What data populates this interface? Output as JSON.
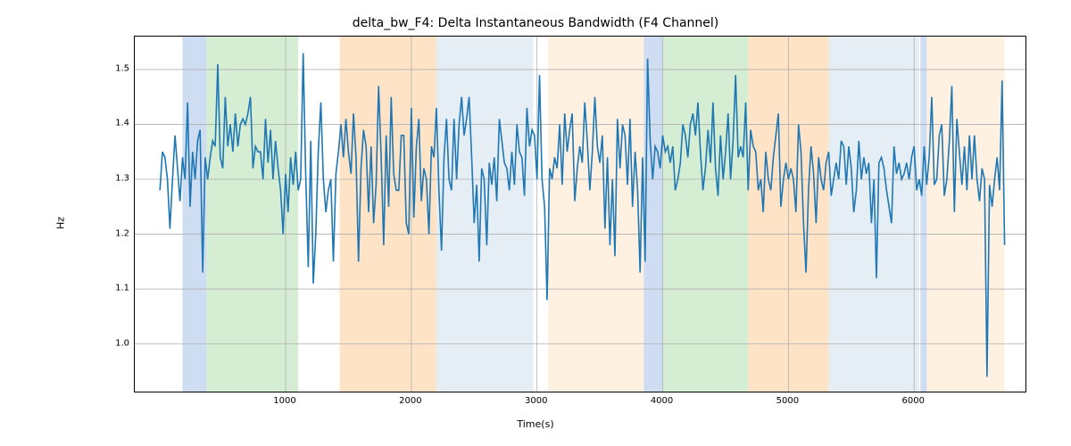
{
  "chart_data": {
    "type": "line",
    "title": "delta_bw_F4: Delta Instantaneous Bandwidth (F4 Channel)",
    "xlabel": "Time(s)",
    "ylabel": "Hz",
    "xlim": [
      -200,
      6900
    ],
    "ylim": [
      0.91,
      1.56
    ],
    "xticks": [
      1000,
      2000,
      3000,
      4000,
      5000,
      6000
    ],
    "yticks": [
      1.0,
      1.1,
      1.2,
      1.3,
      1.4,
      1.5
    ],
    "line_color": "#1f77b4",
    "grid": true,
    "bands": [
      {
        "x0": 180,
        "x1": 370,
        "color": "#aec7e8"
      },
      {
        "x0": 370,
        "x1": 1100,
        "color": "#b7e1b5"
      },
      {
        "x0": 1430,
        "x1": 2200,
        "color": "#fdd0a2"
      },
      {
        "x0": 2200,
        "x1": 2970,
        "color": "#d6e2ef"
      },
      {
        "x0": 3090,
        "x1": 3850,
        "color": "#fde7cd"
      },
      {
        "x0": 3850,
        "x1": 4000,
        "color": "#aec7e8"
      },
      {
        "x0": 4000,
        "x1": 4680,
        "color": "#b7e1b5"
      },
      {
        "x0": 4680,
        "x1": 5320,
        "color": "#fdd0a2"
      },
      {
        "x0": 5320,
        "x1": 6040,
        "color": "#d6e2ef"
      },
      {
        "x0": 6050,
        "x1": 6100,
        "color": "#aec7e8"
      },
      {
        "x0": 6100,
        "x1": 6720,
        "color": "#fde7cd"
      }
    ],
    "x": [
      0,
      20,
      40,
      60,
      80,
      100,
      120,
      140,
      160,
      180,
      200,
      220,
      240,
      260,
      280,
      300,
      320,
      340,
      360,
      380,
      400,
      420,
      440,
      460,
      480,
      500,
      520,
      540,
      560,
      580,
      600,
      620,
      640,
      660,
      680,
      700,
      720,
      740,
      760,
      780,
      800,
      820,
      840,
      860,
      880,
      900,
      920,
      940,
      960,
      980,
      1000,
      1020,
      1040,
      1060,
      1080,
      1100,
      1120,
      1140,
      1160,
      1180,
      1200,
      1220,
      1240,
      1260,
      1280,
      1300,
      1320,
      1340,
      1360,
      1380,
      1400,
      1420,
      1440,
      1460,
      1480,
      1500,
      1520,
      1540,
      1560,
      1580,
      1600,
      1620,
      1640,
      1660,
      1680,
      1700,
      1720,
      1740,
      1760,
      1780,
      1800,
      1820,
      1840,
      1860,
      1880,
      1900,
      1920,
      1940,
      1960,
      1980,
      2000,
      2020,
      2040,
      2060,
      2080,
      2100,
      2120,
      2140,
      2160,
      2180,
      2200,
      2220,
      2240,
      2260,
      2280,
      2300,
      2320,
      2340,
      2360,
      2380,
      2400,
      2420,
      2440,
      2460,
      2480,
      2500,
      2520,
      2540,
      2560,
      2580,
      2600,
      2620,
      2640,
      2660,
      2680,
      2700,
      2720,
      2740,
      2760,
      2780,
      2800,
      2820,
      2840,
      2860,
      2880,
      2900,
      2920,
      2940,
      2960,
      2980,
      3000,
      3020,
      3040,
      3060,
      3080,
      3100,
      3120,
      3140,
      3160,
      3180,
      3200,
      3220,
      3240,
      3260,
      3280,
      3300,
      3320,
      3340,
      3360,
      3380,
      3400,
      3420,
      3440,
      3460,
      3480,
      3500,
      3520,
      3540,
      3560,
      3580,
      3600,
      3620,
      3640,
      3660,
      3680,
      3700,
      3720,
      3740,
      3760,
      3780,
      3800,
      3820,
      3840,
      3860,
      3880,
      3900,
      3920,
      3940,
      3960,
      3980,
      4000,
      4020,
      4040,
      4060,
      4080,
      4100,
      4120,
      4140,
      4160,
      4180,
      4200,
      4220,
      4240,
      4260,
      4280,
      4300,
      4320,
      4340,
      4360,
      4380,
      4400,
      4420,
      4440,
      4460,
      4480,
      4500,
      4520,
      4540,
      4560,
      4580,
      4600,
      4620,
      4640,
      4660,
      4680,
      4700,
      4720,
      4740,
      4760,
      4780,
      4800,
      4820,
      4840,
      4860,
      4880,
      4900,
      4920,
      4940,
      4960,
      4980,
      5000,
      5020,
      5040,
      5060,
      5080,
      5100,
      5120,
      5140,
      5160,
      5180,
      5200,
      5220,
      5240,
      5260,
      5280,
      5300,
      5320,
      5340,
      5360,
      5380,
      5400,
      5420,
      5440,
      5460,
      5480,
      5500,
      5520,
      5540,
      5560,
      5580,
      5600,
      5620,
      5640,
      5660,
      5680,
      5700,
      5720,
      5740,
      5760,
      5780,
      5800,
      5820,
      5840,
      5860,
      5880,
      5900,
      5920,
      5940,
      5960,
      5980,
      6000,
      6020,
      6040,
      6060,
      6080,
      6100,
      6120,
      6140,
      6160,
      6180,
      6200,
      6220,
      6240,
      6260,
      6280,
      6300,
      6320,
      6340,
      6360,
      6380,
      6400,
      6420,
      6440,
      6460,
      6480,
      6500,
      6520,
      6540,
      6560,
      6580,
      6600,
      6620,
      6640,
      6660,
      6680,
      6700,
      6720
    ],
    "values": [
      1.28,
      1.35,
      1.34,
      1.3,
      1.21,
      1.3,
      1.38,
      1.32,
      1.26,
      1.34,
      1.3,
      1.44,
      1.25,
      1.35,
      1.3,
      1.37,
      1.39,
      1.13,
      1.34,
      1.3,
      1.34,
      1.37,
      1.36,
      1.51,
      1.34,
      1.32,
      1.45,
      1.36,
      1.4,
      1.35,
      1.42,
      1.36,
      1.4,
      1.41,
      1.4,
      1.42,
      1.45,
      1.32,
      1.36,
      1.35,
      1.35,
      1.3,
      1.41,
      1.33,
      1.39,
      1.3,
      1.37,
      1.32,
      1.28,
      1.2,
      1.31,
      1.24,
      1.34,
      1.29,
      1.35,
      1.28,
      1.3,
      1.53,
      1.31,
      1.14,
      1.37,
      1.11,
      1.2,
      1.35,
      1.44,
      1.3,
      1.24,
      1.28,
      1.3,
      1.15,
      1.31,
      1.35,
      1.4,
      1.34,
      1.41,
      1.35,
      1.31,
      1.42,
      1.34,
      1.15,
      1.32,
      1.39,
      1.36,
      1.24,
      1.36,
      1.22,
      1.29,
      1.47,
      1.34,
      1.18,
      1.38,
      1.25,
      1.45,
      1.31,
      1.28,
      1.28,
      1.38,
      1.38,
      1.22,
      1.2,
      1.43,
      1.23,
      1.36,
      1.41,
      1.26,
      1.32,
      1.3,
      1.2,
      1.36,
      1.34,
      1.43,
      1.28,
      1.17,
      1.34,
      1.41,
      1.3,
      1.28,
      1.41,
      1.3,
      1.4,
      1.45,
      1.38,
      1.41,
      1.45,
      1.34,
      1.22,
      1.29,
      1.15,
      1.32,
      1.3,
      1.18,
      1.33,
      1.29,
      1.34,
      1.26,
      1.41,
      1.37,
      1.33,
      1.32,
      1.28,
      1.35,
      1.29,
      1.4,
      1.35,
      1.34,
      1.27,
      1.43,
      1.36,
      1.39,
      1.38,
      1.3,
      1.49,
      1.3,
      1.25,
      1.08,
      1.32,
      1.3,
      1.34,
      1.32,
      1.4,
      1.29,
      1.42,
      1.35,
      1.39,
      1.42,
      1.26,
      1.32,
      1.36,
      1.33,
      1.44,
      1.37,
      1.28,
      1.35,
      1.45,
      1.36,
      1.33,
      1.38,
      1.21,
      1.34,
      1.18,
      1.3,
      1.16,
      1.41,
      1.32,
      1.4,
      1.38,
      1.29,
      1.41,
      1.25,
      1.35,
      1.28,
      1.13,
      1.34,
      1.15,
      1.52,
      1.37,
      1.3,
      1.36,
      1.35,
      1.32,
      1.38,
      1.35,
      1.36,
      1.33,
      1.36,
      1.28,
      1.3,
      1.33,
      1.4,
      1.38,
      1.34,
      1.4,
      1.42,
      1.38,
      1.44,
      1.35,
      1.28,
      1.32,
      1.39,
      1.33,
      1.44,
      1.32,
      1.27,
      1.38,
      1.3,
      1.35,
      1.42,
      1.3,
      1.37,
      1.49,
      1.34,
      1.36,
      1.34,
      1.44,
      1.28,
      1.39,
      1.36,
      1.35,
      1.28,
      1.3,
      1.24,
      1.35,
      1.3,
      1.28,
      1.34,
      1.38,
      1.42,
      1.25,
      1.3,
      1.33,
      1.3,
      1.32,
      1.3,
      1.24,
      1.4,
      1.35,
      1.22,
      1.13,
      1.28,
      1.36,
      1.31,
      1.22,
      1.34,
      1.3,
      1.28,
      1.33,
      1.35,
      1.27,
      1.3,
      1.33,
      1.3,
      1.37,
      1.36,
      1.29,
      1.36,
      1.32,
      1.24,
      1.28,
      1.37,
      1.3,
      1.34,
      1.31,
      1.33,
      1.22,
      1.3,
      1.12,
      1.33,
      1.34,
      1.32,
      1.28,
      1.25,
      1.22,
      1.36,
      1.31,
      1.33,
      1.3,
      1.31,
      1.33,
      1.3,
      1.34,
      1.36,
      1.28,
      1.3,
      1.27,
      1.36,
      1.29,
      1.34,
      1.45,
      1.29,
      1.3,
      1.38,
      1.4,
      1.27,
      1.3,
      1.37,
      1.47,
      1.24,
      1.41,
      1.35,
      1.29,
      1.36,
      1.28,
      1.38,
      1.3,
      1.38,
      1.3,
      1.26,
      1.32,
      1.3,
      0.94,
      1.29,
      1.25,
      1.3,
      1.34,
      1.28,
      1.48,
      1.18
    ]
  }
}
